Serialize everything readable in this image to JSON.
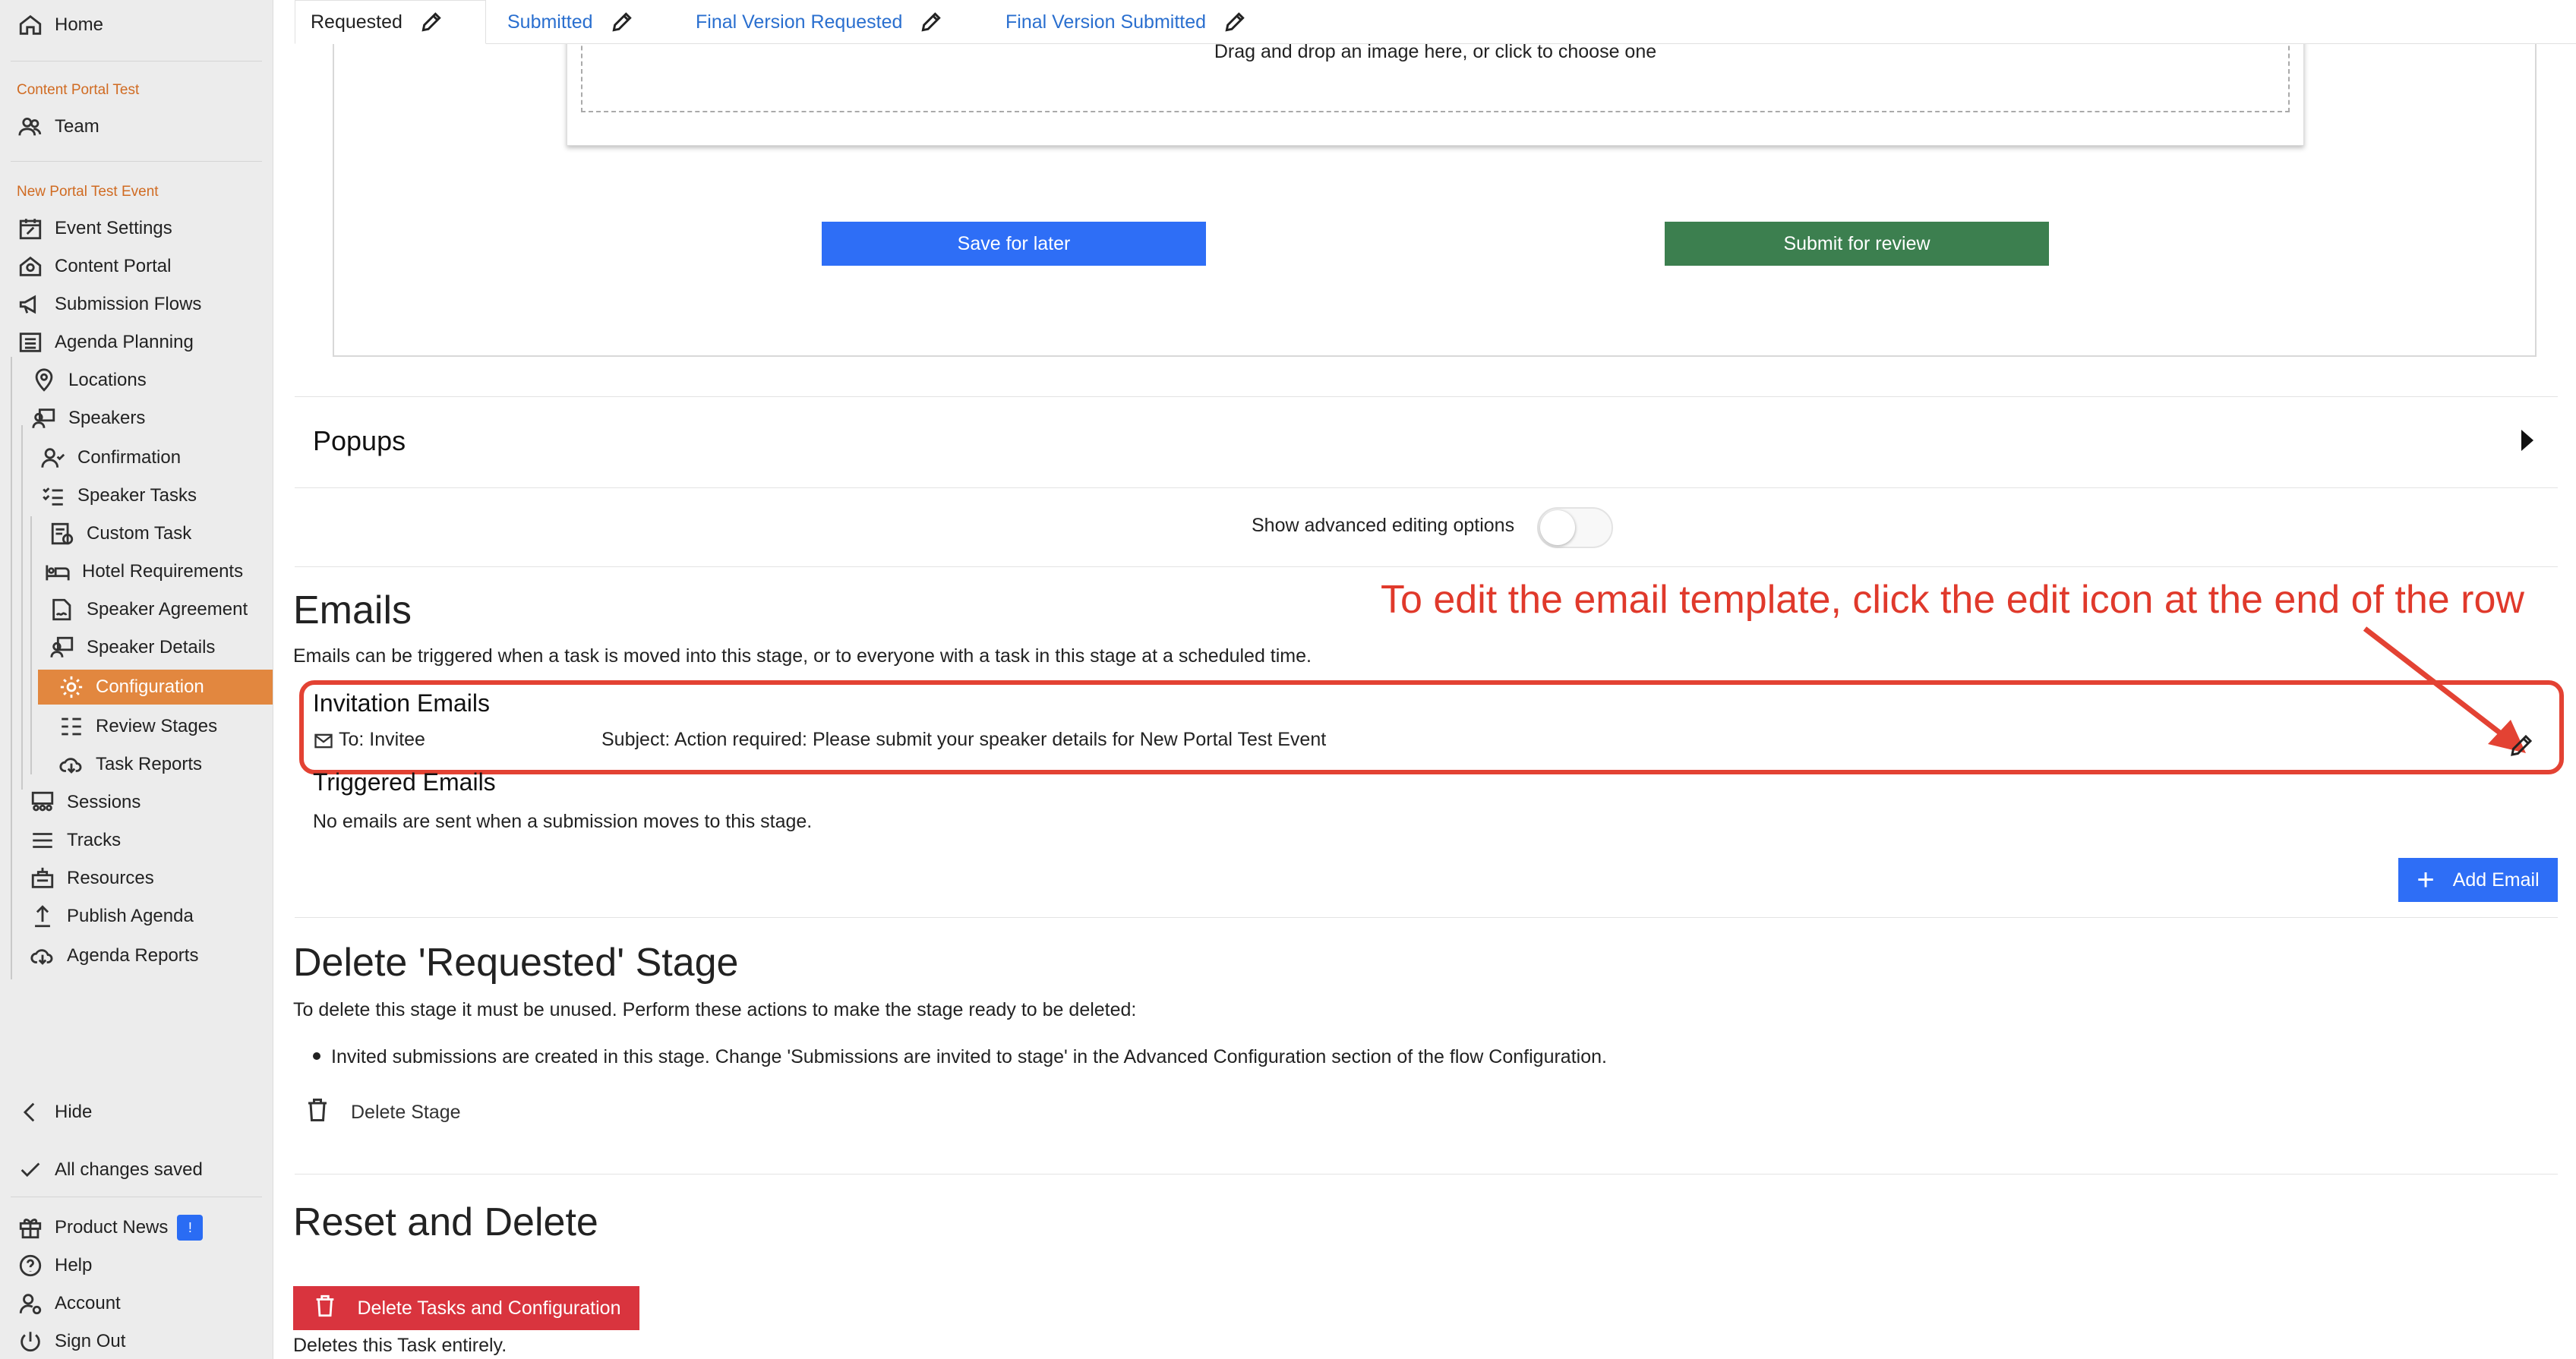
{
  "sidebar": {
    "home": "Home",
    "org_label": "Content Portal Test",
    "team": "Team",
    "event_label": "New Portal Test Event",
    "items": [
      {
        "label": "Event Settings",
        "icon": "calendar-edit-icon"
      },
      {
        "label": "Content Portal",
        "icon": "portal-icon"
      },
      {
        "label": "Submission Flows",
        "icon": "megaphone-icon"
      },
      {
        "label": "Agenda Planning",
        "icon": "list-icon"
      },
      {
        "label": "Locations",
        "icon": "location-pin-icon"
      },
      {
        "label": "Speakers",
        "icon": "speaker-icon"
      },
      {
        "label": "Confirmation",
        "icon": "user-check-icon"
      },
      {
        "label": "Speaker Tasks",
        "icon": "task-list-icon"
      },
      {
        "label": "Custom Task",
        "icon": "custom-task-icon"
      },
      {
        "label": "Hotel Requirements",
        "icon": "bed-icon"
      },
      {
        "label": "Speaker Agreement",
        "icon": "signature-icon"
      },
      {
        "label": "Speaker Details",
        "icon": "speaker-details-icon"
      },
      {
        "label": "Configuration",
        "icon": "gear-icon"
      },
      {
        "label": "Review Stages",
        "icon": "review-stages-icon"
      },
      {
        "label": "Task Reports",
        "icon": "cloud-download-icon"
      },
      {
        "label": "Sessions",
        "icon": "sessions-icon"
      },
      {
        "label": "Tracks",
        "icon": "tracks-icon"
      },
      {
        "label": "Resources",
        "icon": "resources-icon"
      },
      {
        "label": "Publish Agenda",
        "icon": "publish-icon"
      },
      {
        "label": "Agenda Reports",
        "icon": "cloud-download-icon"
      }
    ],
    "hide": "Hide",
    "saved": "All changes saved",
    "product_news": "Product News",
    "product_news_badge": "!",
    "help": "Help",
    "account": "Account",
    "sign_out": "Sign Out"
  },
  "tabs": [
    {
      "label": "Requested",
      "selected": true
    },
    {
      "label": "Submitted",
      "selected": false
    },
    {
      "label": "Final Version Requested",
      "selected": false
    },
    {
      "label": "Final Version Submitted",
      "selected": false
    }
  ],
  "upload": {
    "drop_text": "Drag and drop an image here, or click to choose one",
    "save_label": "Save for later",
    "submit_label": "Submit for review"
  },
  "popups": {
    "title": "Popups"
  },
  "advanced": {
    "label": "Show advanced editing options",
    "enabled": false
  },
  "emails": {
    "title": "Emails",
    "description": "Emails can be triggered when a task is moved into this stage, or to everyone with a task in this stage at a scheduled time.",
    "annotation": "To edit the email template, click the edit icon at the end of the row",
    "invitation": {
      "title": "Invitation Emails",
      "to": "To: Invitee",
      "subject": "Subject: Action required: Please submit your speaker details for New Portal Test Event"
    },
    "triggered": {
      "title": "Triggered Emails",
      "empty_text": "No emails are sent when a submission moves to this stage."
    },
    "add_label": "Add Email"
  },
  "delete_stage": {
    "title": "Delete 'Requested' Stage",
    "description": "To delete this stage it must be unused. Perform these actions to make the stage ready to be deleted:",
    "bullet": "Invited submissions are created in this stage. Change 'Submissions are invited to stage' in the Advanced Configuration section of the flow Configuration.",
    "button": "Delete Stage"
  },
  "reset": {
    "title": "Reset and Delete",
    "button": "Delete Tasks and Configuration",
    "note": "Deletes this Task entirely."
  },
  "colors": {
    "accent": "#e2873f",
    "primary": "#2e6ef6",
    "success": "#3c7f4f",
    "danger": "#d9343e",
    "annotation": "#e0392b"
  }
}
